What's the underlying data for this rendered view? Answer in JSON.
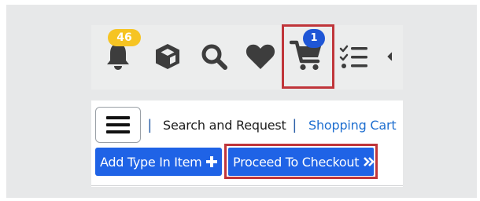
{
  "toolbar": {
    "notifications": {
      "count": "46",
      "icon": "bell-icon"
    },
    "packages": {
      "icon": "cube-icon"
    },
    "search": {
      "icon": "search-icon"
    },
    "favorites": {
      "icon": "heart-icon"
    },
    "cart": {
      "count": "1",
      "icon": "shopping-cart-icon"
    },
    "checklist": {
      "icon": "checklist-icon"
    },
    "more": {
      "icon": "chevron-left-icon"
    }
  },
  "breadcrumb": {
    "separator": "|",
    "current": "Search and Request",
    "link": "Shopping Cart"
  },
  "actions": {
    "add_type_in_item": "Add Type In Item",
    "proceed_to_checkout": "Proceed To Checkout"
  },
  "colors": {
    "accent_blue": "#1f63e6",
    "highlight_red": "#c0353a",
    "notification_badge": "#f6c423",
    "cart_badge": "#1f56d6",
    "icon_dark": "#3d3d3d"
  }
}
